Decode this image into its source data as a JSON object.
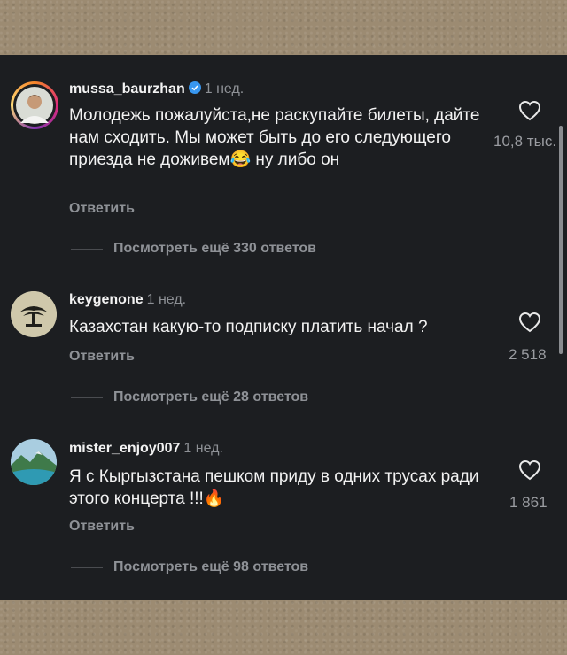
{
  "comments": [
    {
      "username": "mussa_baurzhan",
      "verified": true,
      "time": "1 нед.",
      "text": "Молодежь пожалуйста,не раскупайте билеты, дайте нам сходить. Мы может быть до его следующего приезда не доживем😂 ну либо он",
      "reply_label": "Ответить",
      "likes": "10,8 тыс.",
      "view_replies": "Посмотреть ещё 330 ответов",
      "avatar_icon": "man-portrait-avatar"
    },
    {
      "username": "keygenone",
      "verified": false,
      "time": "1 нед.",
      "text": "Казахстан какую-то подписку платить начал ?",
      "reply_label": "Ответить",
      "likes": "2 518",
      "view_replies": "Посмотреть ещё 28 ответов",
      "avatar_icon": "tree-logo-avatar"
    },
    {
      "username": "mister_enjoy007",
      "verified": false,
      "time": "1 нед.",
      "text": "Я с Кыргызстана пешком приду в одних трусах ради этого концерта !!!🔥",
      "reply_label": "Ответить",
      "likes": "1 861",
      "view_replies": "Посмотреть ещё 98 ответов",
      "avatar_icon": "landscape-avatar"
    }
  ],
  "colors": {
    "background": "#1c1e21",
    "text": "#f2f2f2",
    "secondary": "#8e9196",
    "verified": "#3897f0",
    "frame": "#9c8b72"
  }
}
